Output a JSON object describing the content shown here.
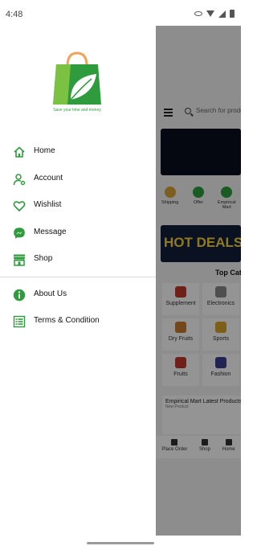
{
  "status_bar": {
    "time": "4:48"
  },
  "drawer": {
    "logo_tagline": "Save your time and money",
    "menu_items": [
      {
        "label": "Home",
        "icon": "home-icon"
      },
      {
        "label": "Account",
        "icon": "account-icon"
      },
      {
        "label": "Wishlist",
        "icon": "heart-icon"
      },
      {
        "label": "Message",
        "icon": "messenger-icon"
      },
      {
        "label": "Shop",
        "icon": "shop-icon"
      }
    ],
    "secondary_items": [
      {
        "label": "About Us",
        "icon": "info-icon"
      },
      {
        "label": "Terms & Condition",
        "icon": "list-icon"
      }
    ]
  },
  "background_app": {
    "search_placeholder": "Search for products",
    "quick_categories": [
      "Shipping",
      "Offer",
      "Empirical Mart"
    ],
    "hot_deals": "HOT DEALS",
    "top_categories_title": "Top Categories",
    "categories": [
      "Supplement",
      "Electronics",
      "Dry Fruits",
      "Sports",
      "Fruits",
      "Fashion"
    ],
    "latest_title": "Empirical Mart Latest Products",
    "latest_subtitle": "New Product",
    "bottom_nav": [
      "Place Order",
      "Shop",
      "Home"
    ]
  },
  "colors": {
    "accent": "#2e9b3d",
    "accent_light": "#7cc242",
    "handle": "#f0a35a",
    "scrim": "rgba(0,0,0,0.42)"
  }
}
